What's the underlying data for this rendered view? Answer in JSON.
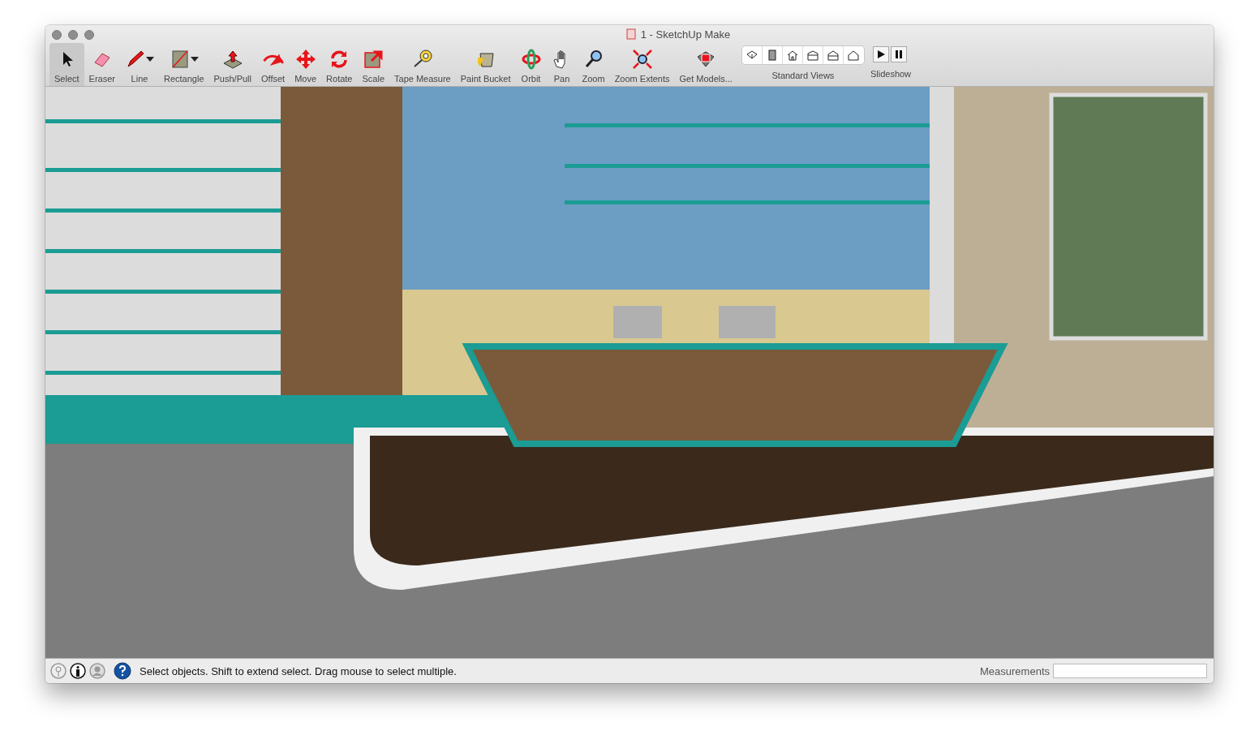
{
  "window": {
    "title": "1 - SketchUp Make"
  },
  "toolbar": {
    "tools": [
      {
        "label": "Select",
        "kind": "select",
        "selected": true,
        "dropdown": false
      },
      {
        "label": "Eraser",
        "kind": "eraser",
        "selected": false,
        "dropdown": false
      },
      {
        "label": "Line",
        "kind": "line",
        "selected": false,
        "dropdown": true
      },
      {
        "label": "Rectangle",
        "kind": "rectangle",
        "selected": false,
        "dropdown": true
      },
      {
        "label": "Push/Pull",
        "kind": "pushpull",
        "selected": false,
        "dropdown": false
      },
      {
        "label": "Offset",
        "kind": "offset",
        "selected": false,
        "dropdown": false
      },
      {
        "label": "Move",
        "kind": "move",
        "selected": false,
        "dropdown": false
      },
      {
        "label": "Rotate",
        "kind": "rotate",
        "selected": false,
        "dropdown": false
      },
      {
        "label": "Scale",
        "kind": "scale",
        "selected": false,
        "dropdown": false
      },
      {
        "label": "Tape Measure",
        "kind": "tape",
        "selected": false,
        "dropdown": false
      },
      {
        "label": "Paint Bucket",
        "kind": "bucket",
        "selected": false,
        "dropdown": false
      },
      {
        "label": "Orbit",
        "kind": "orbit",
        "selected": false,
        "dropdown": false
      },
      {
        "label": "Pan",
        "kind": "pan",
        "selected": false,
        "dropdown": false
      },
      {
        "label": "Zoom",
        "kind": "zoom",
        "selected": false,
        "dropdown": false
      },
      {
        "label": "Zoom Extents",
        "kind": "extents",
        "selected": false,
        "dropdown": false
      },
      {
        "label": "Get Models...",
        "kind": "models",
        "selected": false,
        "dropdown": false
      }
    ],
    "standard_views": {
      "label": "Standard Views",
      "views": [
        {
          "kind": "iso"
        },
        {
          "kind": "top"
        },
        {
          "kind": "front"
        },
        {
          "kind": "right"
        },
        {
          "kind": "back"
        },
        {
          "kind": "left"
        }
      ]
    },
    "slideshow": {
      "label": "Slideshow",
      "buttons": [
        {
          "kind": "play"
        },
        {
          "kind": "pause"
        }
      ]
    }
  },
  "status_bar": {
    "message": "Select objects. Shift to extend select. Drag mouse to select multiple.",
    "measurements_label": "Measurements"
  }
}
